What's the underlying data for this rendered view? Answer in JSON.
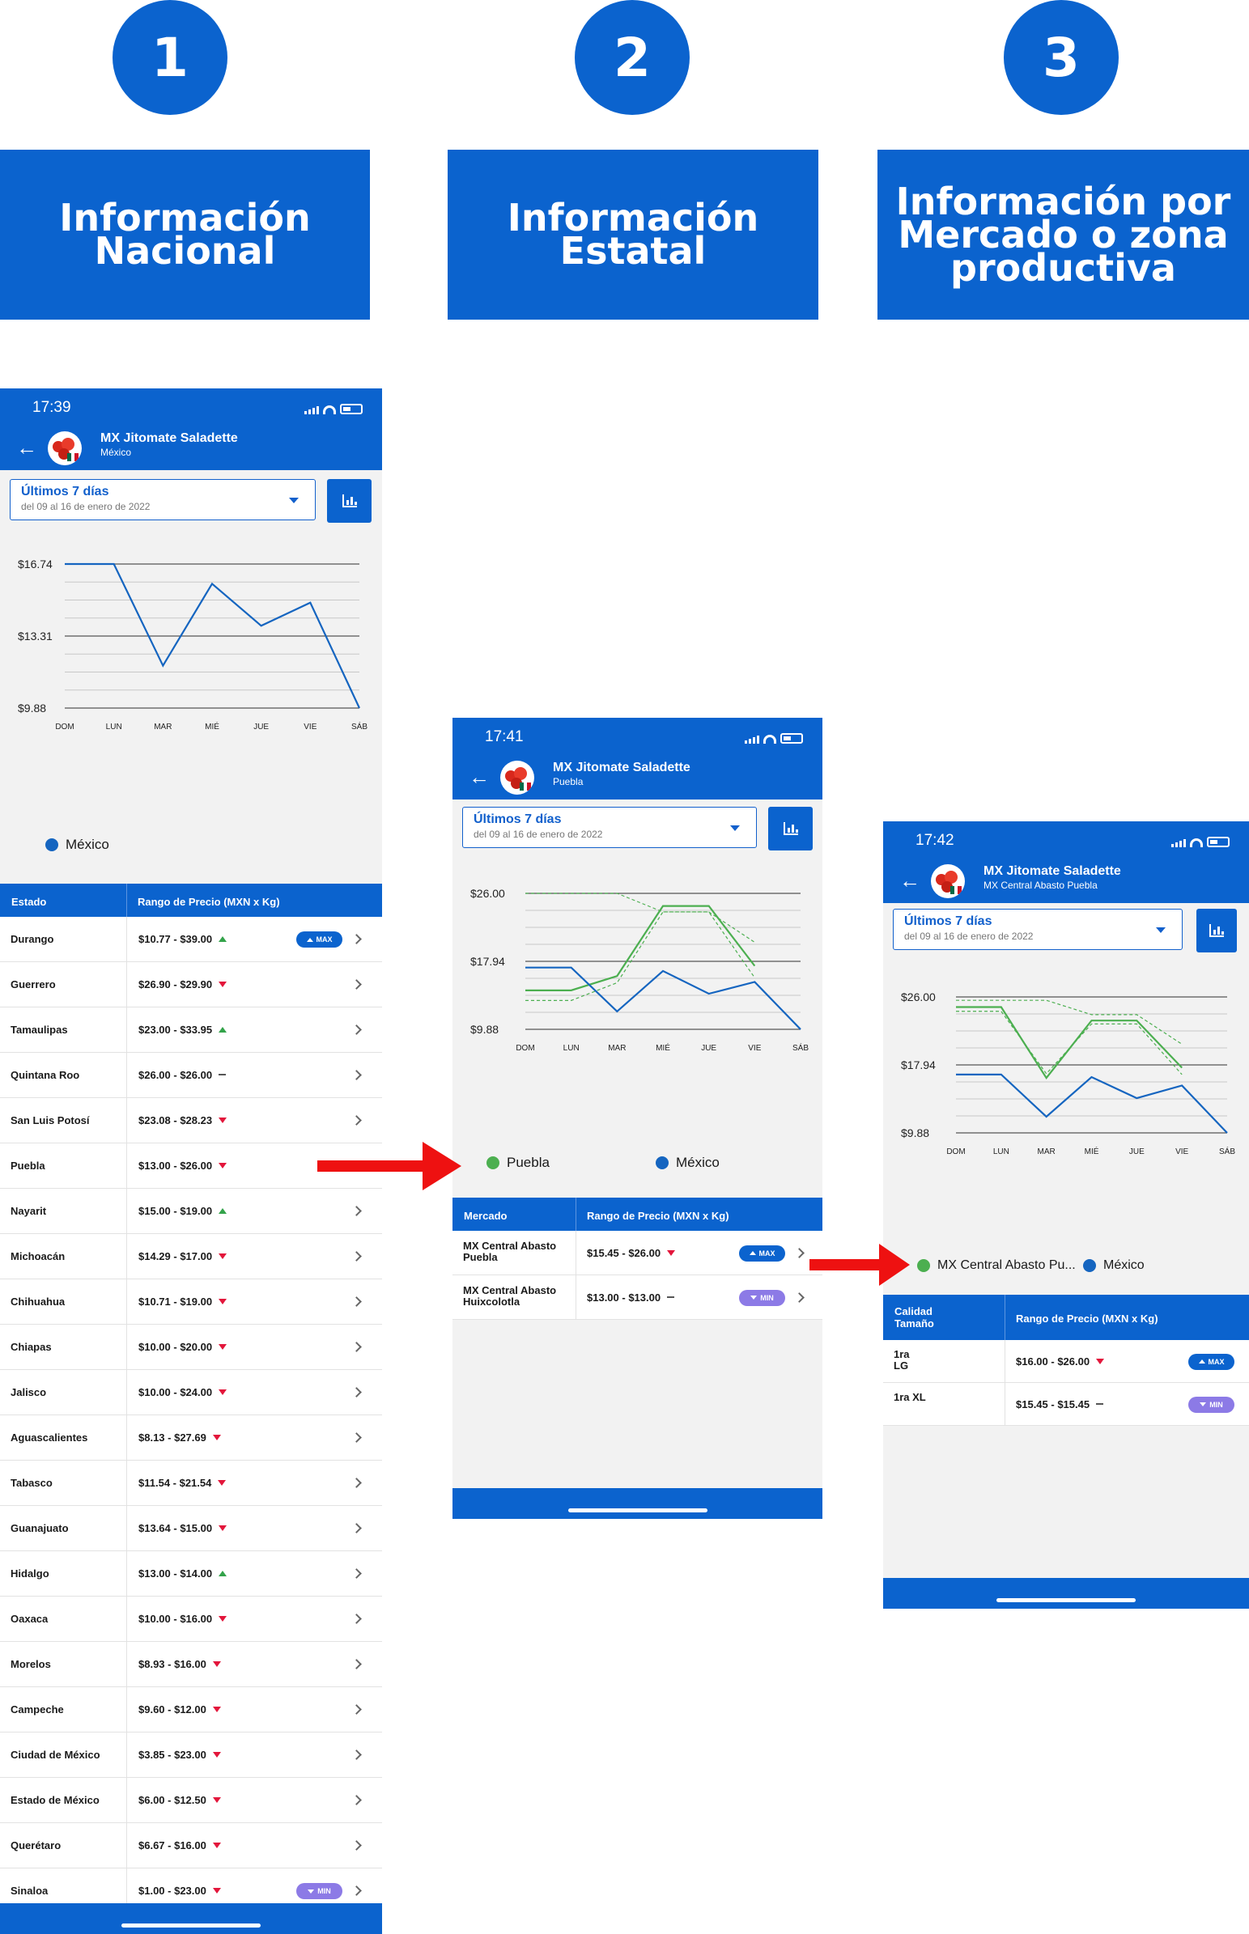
{
  "steps": [
    {
      "number": "1",
      "title_lines": [
        "Información",
        "Nacional"
      ]
    },
    {
      "number": "2",
      "title_lines": [
        "Información",
        "Estatal"
      ]
    },
    {
      "number": "3",
      "title_lines": [
        "Información por",
        "Mercado o zona",
        "productiva"
      ]
    }
  ],
  "colors": {
    "brand": "#0b63ce",
    "up": "#33a34a",
    "down": "#e3163b",
    "green_series": "#4caf50",
    "blue_series": "#1565c0",
    "max_badge": "#0b63ce",
    "min_badge": "#8c7ae6",
    "arrow": "#ee1111"
  },
  "icons": {
    "back": "arrow-left-icon",
    "dropdown": "caret-down-icon",
    "chart": "bar-chart-icon",
    "row": "chevron-right-icon"
  },
  "screens": {
    "national": {
      "time": "17:39",
      "title": "MX Jitomate Saladette",
      "subtitle": "México",
      "dropdown_title": "Últimos 7 días",
      "dropdown_sub": "del 09 al 16 de enero de 2022",
      "legend": [
        "México"
      ],
      "table_headers": [
        "Estado",
        "Rango de Precio (MXN x Kg)"
      ],
      "rows": [
        {
          "name": "Durango",
          "range": "$10.77 - $39.00",
          "trend": "up",
          "badge": "MAX"
        },
        {
          "name": "Guerrero",
          "range": "$26.90 - $29.90",
          "trend": "down"
        },
        {
          "name": "Tamaulipas",
          "range": "$23.00 - $33.95",
          "trend": "up"
        },
        {
          "name": "Quintana Roo",
          "range": "$26.00 - $26.00",
          "trend": "flat"
        },
        {
          "name": "San Luis Potosí",
          "range": "$23.08 - $28.23",
          "trend": "down"
        },
        {
          "name": "Puebla",
          "range": "$13.00 - $26.00",
          "trend": "down"
        },
        {
          "name": "Nayarit",
          "range": "$15.00 - $19.00",
          "trend": "up"
        },
        {
          "name": "Michoacán",
          "range": "$14.29 - $17.00",
          "trend": "down"
        },
        {
          "name": "Chihuahua",
          "range": "$10.71 - $19.00",
          "trend": "down"
        },
        {
          "name": "Chiapas",
          "range": "$10.00 - $20.00",
          "trend": "down"
        },
        {
          "name": "Jalisco",
          "range": "$10.00 - $24.00",
          "trend": "down"
        },
        {
          "name": "Aguascalientes",
          "range": "$8.13 - $27.69",
          "trend": "down"
        },
        {
          "name": "Tabasco",
          "range": "$11.54 - $21.54",
          "trend": "down"
        },
        {
          "name": "Guanajuato",
          "range": "$13.64 - $15.00",
          "trend": "down"
        },
        {
          "name": "Hidalgo",
          "range": "$13.00 - $14.00",
          "trend": "up"
        },
        {
          "name": "Oaxaca",
          "range": "$10.00 - $16.00",
          "trend": "down"
        },
        {
          "name": "Morelos",
          "range": "$8.93 - $16.00",
          "trend": "down"
        },
        {
          "name": "Campeche",
          "range": "$9.60 - $12.00",
          "trend": "down"
        },
        {
          "name": "Ciudad de México",
          "range": "$3.85 - $23.00",
          "trend": "down"
        },
        {
          "name": "Estado de México",
          "range": "$6.00 - $12.50",
          "trend": "down"
        },
        {
          "name": "Querétaro",
          "range": "$6.67 - $16.00",
          "trend": "down"
        },
        {
          "name": "Sinaloa",
          "range": "$1.00 - $23.00",
          "trend": "down",
          "badge": "MIN"
        }
      ]
    },
    "state": {
      "time": "17:41",
      "title": "MX Jitomate Saladette",
      "subtitle": "Puebla",
      "dropdown_title": "Últimos 7 días",
      "dropdown_sub": "del 09 al 16 de enero de 2022",
      "legend": [
        "Puebla",
        "México"
      ],
      "table_headers": [
        "Mercado",
        "Rango de Precio (MXN x Kg)"
      ],
      "rows": [
        {
          "name": "MX Central Abasto Puebla",
          "range": "$15.45 - $26.00",
          "trend": "down",
          "badge": "MAX"
        },
        {
          "name": "MX Central Abasto Huixcolotla",
          "range": "$13.00 - $13.00",
          "trend": "flat",
          "badge": "MIN"
        }
      ]
    },
    "market": {
      "time": "17:42",
      "title": "MX Jitomate Saladette",
      "subtitle": "MX Central Abasto Puebla",
      "dropdown_title": "Últimos 7 días",
      "dropdown_sub": "del 09 al 16 de enero de 2022",
      "legend": [
        "MX Central Abasto Pu...",
        "México"
      ],
      "table_headers": [
        "Calidad Tamaño",
        "Rango de Precio (MXN x Kg)"
      ],
      "rows": [
        {
          "name": "1ra LG",
          "range": "$16.00 - $26.00",
          "trend": "down",
          "badge": "MAX"
        },
        {
          "name": "1ra XL",
          "range": "$15.45 - $15.45",
          "trend": "flat",
          "badge": "MIN"
        }
      ]
    }
  },
  "chart_data": [
    {
      "type": "line",
      "x": [
        "DOM",
        "LUN",
        "MAR",
        "MIÉ",
        "JUE",
        "VIE",
        "SÁB"
      ],
      "y_ticks": [
        "$16.74",
        "$13.31",
        "$9.88"
      ],
      "ylim": [
        9.88,
        16.74
      ],
      "series": [
        {
          "name": "México",
          "values": [
            16.74,
            16.74,
            11.9,
            15.8,
            13.8,
            14.9,
            9.88
          ]
        }
      ],
      "grid": true,
      "legend_position": "bottom-left"
    },
    {
      "type": "line",
      "x": [
        "DOM",
        "LUN",
        "MAR",
        "MIÉ",
        "JUE",
        "VIE",
        "SÁB"
      ],
      "y_ticks": [
        "$26.00",
        "$17.94",
        "$9.88"
      ],
      "ylim": [
        9.88,
        26.0
      ],
      "series": [
        {
          "name": "Puebla",
          "values": [
            14.5,
            14.5,
            16.2,
            24.5,
            24.5,
            17.4
          ]
        },
        {
          "name": "Puebla-range-high",
          "style": "dashed",
          "values": [
            26.0,
            26.0,
            26.0,
            23.8,
            23.8,
            20.2
          ]
        },
        {
          "name": "Puebla-range-low",
          "style": "dashed",
          "values": [
            13.3,
            13.3,
            15.4,
            23.8,
            23.8,
            16.0
          ]
        },
        {
          "name": "México",
          "values": [
            17.2,
            17.2,
            12.0,
            16.8,
            14.1,
            15.5,
            9.88
          ]
        }
      ],
      "grid": true,
      "legend_position": "bottom"
    },
    {
      "type": "line",
      "x": [
        "DOM",
        "LUN",
        "MAR",
        "MIÉ",
        "JUE",
        "VIE",
        "SÁB"
      ],
      "y_ticks": [
        "$26.00",
        "$17.94",
        "$9.88"
      ],
      "ylim": [
        9.88,
        26.0
      ],
      "series": [
        {
          "name": "MX Central Abasto Pu...",
          "values": [
            24.8,
            24.8,
            16.4,
            23.2,
            23.2,
            17.6
          ]
        },
        {
          "name": "MX Central Abasto Pu...-range-high",
          "style": "dashed",
          "values": [
            25.6,
            25.6,
            25.6,
            23.9,
            23.9,
            20.4
          ]
        },
        {
          "name": "MX Central Abasto Pu...-range-low",
          "style": "dashed",
          "values": [
            24.3,
            24.3,
            16.9,
            22.8,
            22.8,
            16.8
          ]
        },
        {
          "name": "México",
          "values": [
            16.8,
            16.8,
            11.8,
            16.5,
            14.0,
            15.5,
            9.88
          ]
        }
      ],
      "grid": true,
      "legend_position": "bottom"
    }
  ]
}
